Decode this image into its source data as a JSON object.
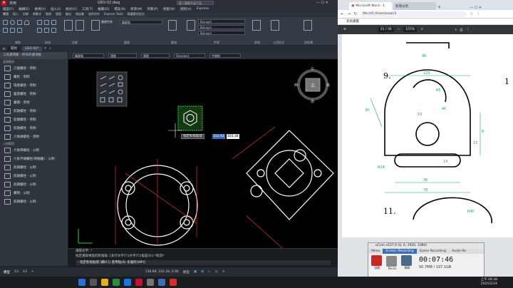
{
  "cad": {
    "title": "GEO-02.dwg",
    "app_name": "共用",
    "search_placeholder": "鍵入關鍵字或片語",
    "menu": [
      "檔案(F)",
      "編輯(E)",
      "檢視(V)",
      "插入(I)",
      "格式(O)",
      "工具(T)",
      "繪圖(D)",
      "標註(N)",
      "修改(M)",
      "參數(P)",
      "視窗(W)",
      "說明(H)",
      "Express"
    ],
    "ribbon_tabs": [
      "常用",
      "插入",
      "註解",
      "參數式",
      "檢視",
      "管理",
      "輸出",
      "增益集",
      "協同合作",
      "Express Tools",
      "精選應用程式"
    ],
    "ribbon_groups": [
      "繪製",
      "修改",
      "註解",
      "圖層",
      "圖塊",
      "性質",
      "群組",
      "公用程式",
      "剪貼簿"
    ],
    "layer_values": [
      "ByLayer",
      "ByLayer",
      "ByLayer"
    ],
    "layer_label": "圖層性質",
    "file_tabs": [
      "開始",
      "GEO-02*"
    ],
    "prop_values": [
      "輪廓線",
      "隨層",
      "隨層",
      "Standard",
      "中間線"
    ],
    "palette_title": "工具選項板 - 所有的選項板",
    "palette_items": [
      "凸面螺栓 - 英制",
      "螺栓 - 英制",
      "環座螺栓 - 英制",
      "面座螺栓 - 英制",
      "螺帽 - 英制",
      "鉸鏈螺栓 - 英制",
      "鉸鏈螺栓 - 英制",
      "鉸鏈螺栓 - 英制",
      "六角頭螺栓 - 英制"
    ],
    "palette_section": "公制範例",
    "palette_items2": [
      "六角帶螺栓 - 公制",
      "六角平頭螺栓(帶翻腹) - 公制",
      "鉸鏈螺栓 - 公制",
      "鉸鏈螺栓 - 公制",
      "鉸鏈螺栓 - 公制",
      "螺帽 - 公制",
      "鉸鏈螺栓 - 公制"
    ],
    "viewcube": {
      "north": "北",
      "south": "南",
      "west": "西",
      "east": "東",
      "top": "上"
    },
    "dyn_input_label": "指定對角點或",
    "dyn_input_x": "162.93",
    "dyn_input_y": "101.34",
    "cmd_history": [
      "選取文字: *",
      "指定選取視窗的對角點: [多行文字(T)/文字(T)/角度(A)] *取消*"
    ],
    "cmd_input": "- 指定對角點或 [欄(C)] 基準點(B) 多邊形(WP)]",
    "model_tabs": [
      "模型",
      "A3",
      "A3"
    ],
    "coords": "138.69, 332.34, 0.00",
    "status_mode": "模型"
  },
  "browser": {
    "tabs": [
      "Microsoft Word - 1",
      "新增分頁"
    ],
    "url": "file:///C:/Users/user/1",
    "bookmark": "其他書籤",
    "page_indicator": "31 / 36",
    "zoom": "155%"
  },
  "pdf": {
    "problem_numbers": [
      "9.",
      "11.",
      "1"
    ],
    "dims": [
      "96",
      "120",
      "R5",
      "30",
      "40",
      "53",
      "R14",
      "14",
      "15",
      "8",
      "36",
      "78",
      "R40"
    ]
  },
  "recorder": {
    "title": "oCam v537.0 (0, 0, 1920, 1080)",
    "tabs": [
      "Menu",
      "Screen Recording",
      "Game Recording",
      "Audio Re"
    ],
    "buttons": [
      "錄影",
      "Pause",
      "擷取"
    ],
    "elapsed": "00:07:46",
    "size": "50.7MB / 197.1GB"
  },
  "taskbar": {
    "time": "上午 08:38",
    "date": "2025/2/24"
  },
  "colors": {
    "accent_green": "#33cc33",
    "cad_bg": "#000000",
    "dim_color": "#ff3b3b",
    "white": "#ffffff"
  }
}
